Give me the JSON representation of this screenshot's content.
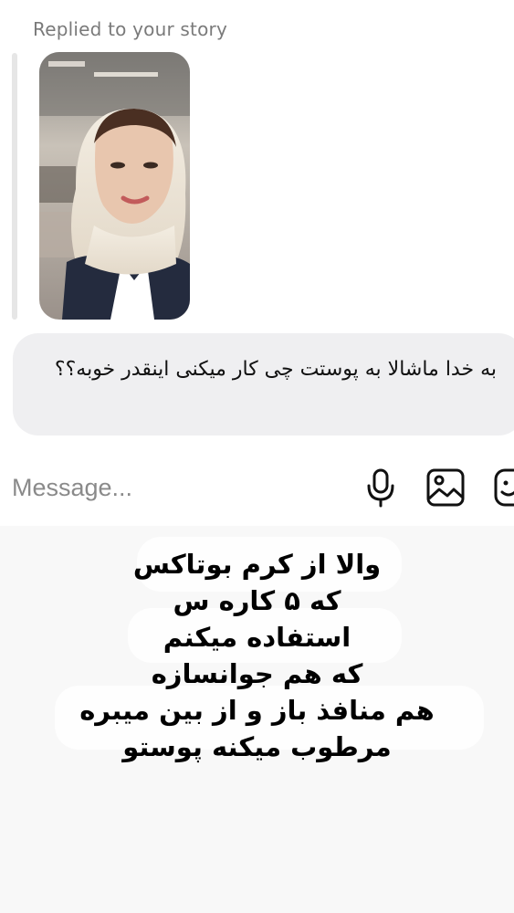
{
  "story_reply": {
    "replied_label": "Replied to your story",
    "thumbnail_icon": "story-photo-icon"
  },
  "message": {
    "text": "به خدا ماشالا به پوستت چی کار میکنی اینقدر خوبه؟؟"
  },
  "composer": {
    "placeholder": "Message...",
    "icons": [
      "microphone-icon",
      "photo-icon",
      "sticker-icon"
    ]
  },
  "caption": {
    "lines": [
      "والا از کرم بوتاکس",
      "که ۵ کاره س",
      "استفاده میکنم",
      "که هم جوانسازه",
      "هم منافذ باز و از بین میبره",
      "مرطوب میکنه پوستو"
    ]
  },
  "colors": {
    "bubble": "#efeff1",
    "label_gray": "#7a7a7a",
    "caption_bg": "#f8f8f8"
  }
}
